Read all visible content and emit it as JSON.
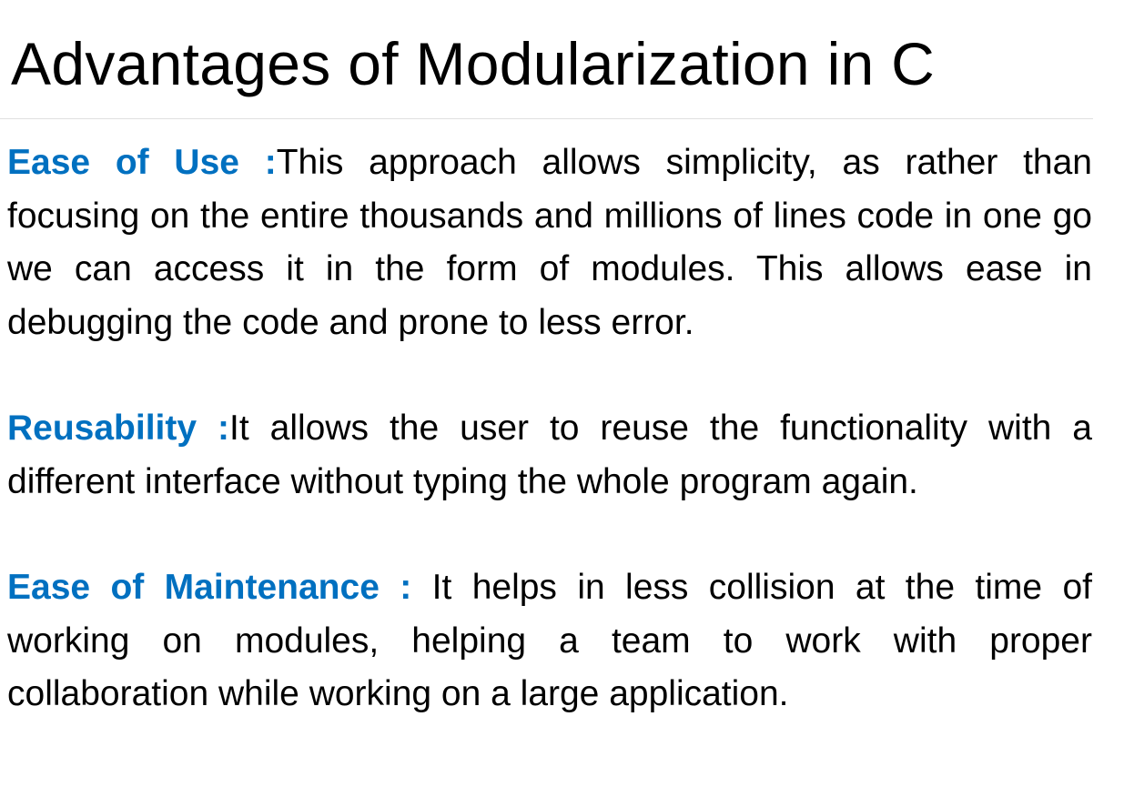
{
  "slide": {
    "title": "Advantages of Modularization in C",
    "points": [
      {
        "term": "Ease of Use :",
        "text": "This approach allows simplicity, as rather than focusing on the entire thousands and millions of lines code in one go we can access it in the form of modules. This allows ease in debugging the code and prone to less error."
      },
      {
        "term": "Reusability :",
        "text": "It allows the user to reuse the functionality with a different interface without typing the whole program again."
      },
      {
        "term": "Ease of Maintenance :",
        "text": " It helps in less collision at the time of working on modules, helping a team to work with proper collaboration while working on a large application."
      }
    ]
  },
  "colors": {
    "term": "#0070c0",
    "text": "#000000",
    "background": "#ffffff"
  }
}
